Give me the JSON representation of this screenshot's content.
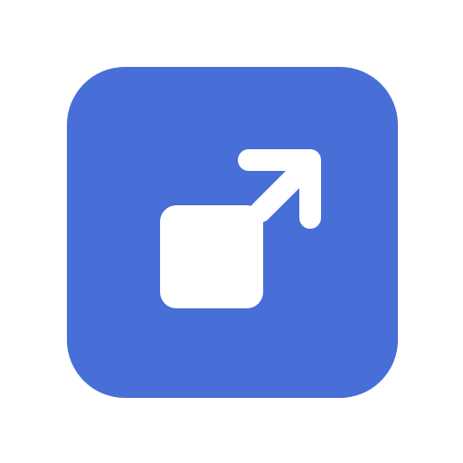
{
  "icon": {
    "name": "open-external-icon",
    "tile_color": "#486ed8",
    "glyph_color": "#ffffff"
  }
}
